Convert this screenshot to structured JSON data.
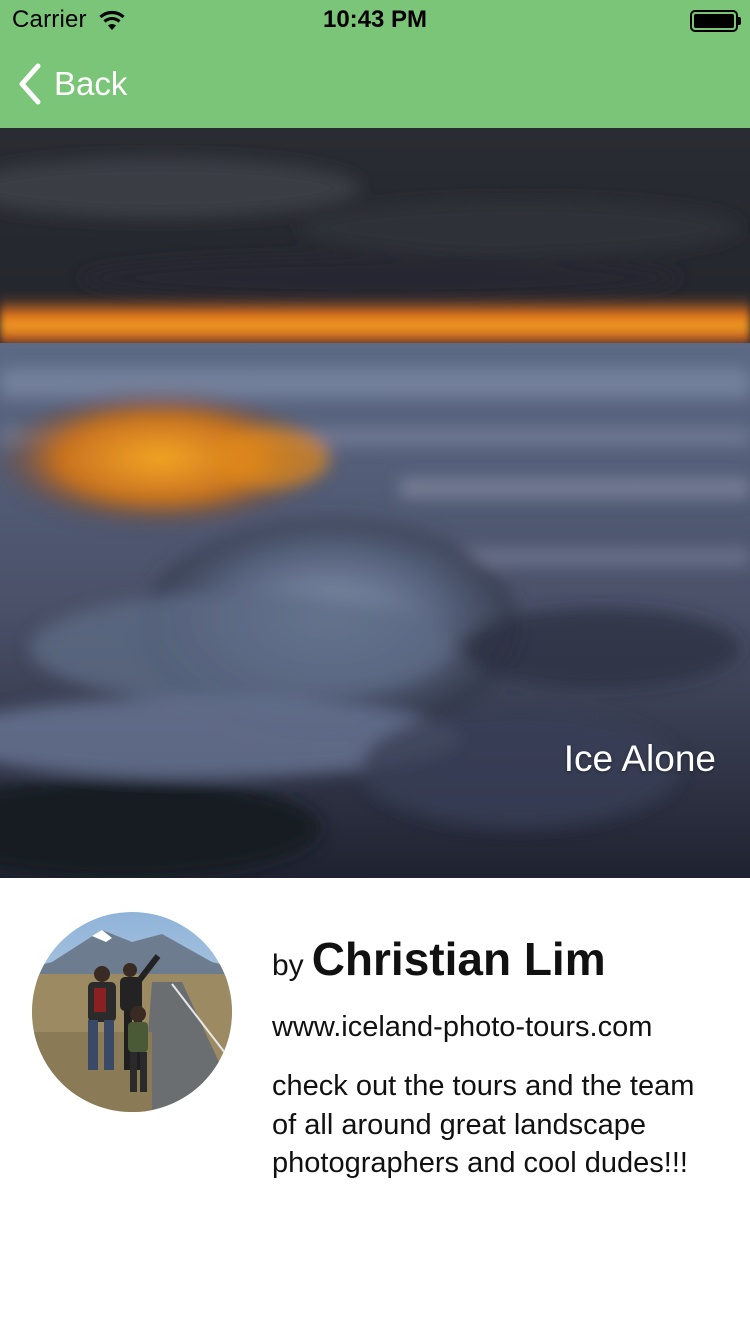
{
  "status_bar": {
    "carrier": "Carrier",
    "time": "10:43 PM"
  },
  "nav": {
    "back_label": "Back",
    "back_icon": "chevron-left-icon",
    "bar_color": "#7ac577"
  },
  "photo": {
    "title": "Ice Alone"
  },
  "author": {
    "by_prefix": "by",
    "name": "Christian Lim",
    "website": "www.iceland-photo-tours.com",
    "description": "check out the tours and the team of all around great landscape photographers and cool dudes!!!"
  }
}
